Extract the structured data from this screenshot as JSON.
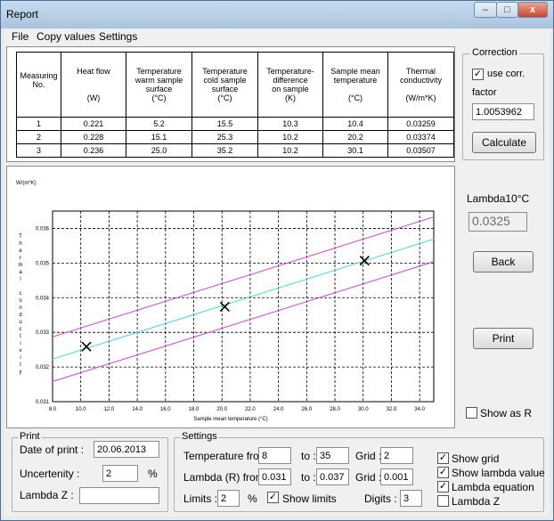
{
  "window": {
    "title": "Report"
  },
  "menu": [
    "File",
    "Copy values",
    "Settings"
  ],
  "table": {
    "headers": [
      [
        "Measuring",
        "No.",
        ""
      ],
      [
        "Heat flow",
        "",
        "(W)"
      ],
      [
        "Temperature",
        "warm sample",
        "surface",
        "(°C)"
      ],
      [
        "Temperature",
        "cold sample",
        "surface",
        "(°C)"
      ],
      [
        "Temperature-",
        "difference",
        "on sample",
        "(K)"
      ],
      [
        "Sample mean",
        "temperature",
        "",
        "(°C)"
      ],
      [
        "Thermal",
        "conductivity",
        "",
        "(W/m*K)"
      ]
    ],
    "rows": [
      [
        "1",
        "0.221",
        "5.2",
        "15.5",
        "10.3",
        "10.4",
        "0.03259"
      ],
      [
        "2",
        "0.228",
        "15.1",
        "25.3",
        "10.2",
        "20.2",
        "0.03374"
      ],
      [
        "3",
        "0.236",
        "25.0",
        "35.2",
        "10.2",
        "30.1",
        "0.03507"
      ]
    ]
  },
  "correction": {
    "title": "Correction",
    "use_corr_label": "use corr.",
    "use_corr_checked": true,
    "factor_label": "factor",
    "factor_value": "1.0053962",
    "calculate_label": "Calculate"
  },
  "lambda10": {
    "label": "Lambda10°C",
    "value": "0.0325"
  },
  "buttons": {
    "back": "Back",
    "print": "Print"
  },
  "show_as_r": {
    "label": "Show as R",
    "checked": false
  },
  "chart_data": {
    "type": "scatter",
    "ylabel_top": "W/(m*K)",
    "ylabel_side": "Thermal conductivity",
    "xlabel": "Sample mean temperature (°C)",
    "xlim": [
      8,
      35
    ],
    "ylim": [
      0.031,
      0.0365
    ],
    "x_ticks": [
      "8.0",
      "10.0",
      "12.0",
      "14.0",
      "16.0",
      "18.0",
      "20.0",
      "22.0",
      "24.0",
      "26.0",
      "28.0",
      "30.0",
      "32.0",
      "34.0"
    ],
    "y_ticks": [
      "0.031",
      "0.032",
      "0.033",
      "0.034",
      "0.035",
      "0.036"
    ],
    "points": [
      {
        "x": 10.4,
        "y": 0.03259
      },
      {
        "x": 20.2,
        "y": 0.03374
      },
      {
        "x": 30.1,
        "y": 0.03507
      }
    ],
    "lines": [
      {
        "role": "regression",
        "color": "#55dcdc",
        "from": [
          8,
          0.03223
        ],
        "to": [
          35,
          0.03569
        ]
      },
      {
        "role": "upper-limit",
        "color": "#d94fd9",
        "from": [
          8,
          0.03287
        ],
        "to": [
          35,
          0.03633
        ]
      },
      {
        "role": "lower-limit",
        "color": "#d94fd9",
        "from": [
          8,
          0.03158
        ],
        "to": [
          35,
          0.03504
        ]
      }
    ]
  },
  "print": {
    "title": "Print",
    "date_label": "Date of print :",
    "date_value": "20.06.2013",
    "uncertainty_label": "Uncertenity :",
    "uncertainty_value": "2",
    "percent": "%",
    "lambda_z_label": "Lambda Z :",
    "lambda_z_value": ""
  },
  "settings": {
    "title": "Settings",
    "temp_from_label": "Temperature from :",
    "temp_from": "8",
    "to_label": "to :",
    "temp_to": "35",
    "grid_label": "Grid :",
    "temp_grid": "2",
    "lambda_from_label": "Lambda (R) from :",
    "lambda_from": "0.031",
    "lambda_to": "0.037",
    "lambda_grid": "0.001",
    "limits_label": "Limits :",
    "limits_value": "2",
    "percent": "%",
    "show_limits_label": "Show limits",
    "digits_label": "Digits :",
    "digits_value": "3"
  },
  "options": [
    {
      "label": "Show grid",
      "checked": true
    },
    {
      "label": "Show lambda value",
      "checked": true
    },
    {
      "label": "Lambda equation",
      "checked": true
    },
    {
      "label": "Lambda Z",
      "checked": false
    }
  ]
}
